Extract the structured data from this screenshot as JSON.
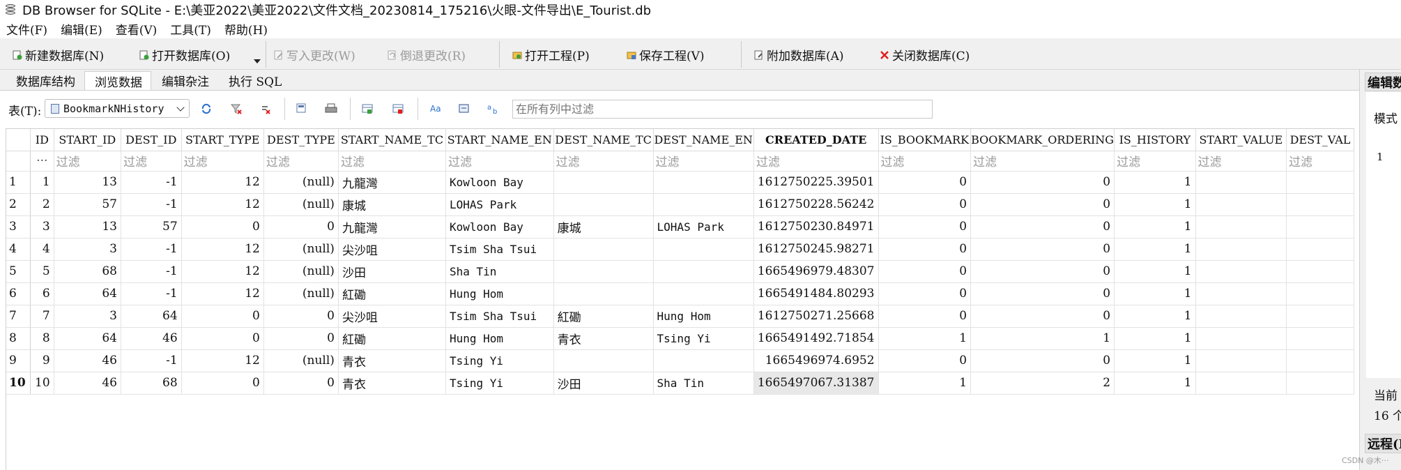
{
  "window": {
    "title": "DB Browser for SQLite - E:\\美亚2022\\美亚2022\\文件文档_20230814_175216\\火眼-文件导出\\E_Tourist.db"
  },
  "menu": [
    "文件(F)",
    "编辑(E)",
    "查看(V)",
    "工具(T)",
    "帮助(H)"
  ],
  "toolbar": {
    "new_db": "新建数据库(N)",
    "open_db": "打开数据库(O)",
    "write_changes": "写入更改(W)",
    "revert_changes": "倒退更改(R)",
    "open_project": "打开工程(P)",
    "save_project": "保存工程(V)",
    "attach_db": "附加数据库(A)",
    "close_db": "关闭数据库(C)"
  },
  "tabs": [
    "数据库结构",
    "浏览数据",
    "编辑杂注",
    "执行 SQL"
  ],
  "active_tab": "浏览数据",
  "browse": {
    "table_label": "表(T):",
    "table_name": "BookmarkNHistory",
    "filter_all_placeholder": "在所有列中过滤",
    "filter_corner": "···",
    "filter_placeholder": "过滤"
  },
  "grid": {
    "columns": [
      "ID",
      "START_ID",
      "DEST_ID",
      "START_TYPE",
      "DEST_TYPE",
      "START_NAME_TC",
      "START_NAME_EN",
      "DEST_NAME_TC",
      "DEST_NAME_EN",
      "CREATED_DATE",
      "IS_BOOKMARK",
      "BOOKMARK_ORDERING",
      "IS_HISTORY",
      "START_VALUE",
      "DEST_VAL"
    ],
    "sorted_column": "CREATED_DATE",
    "current_row": "10",
    "rows": [
      {
        "n": "1",
        "cells": [
          "1",
          "13",
          "-1",
          "12",
          "(null)",
          "九龍灣",
          "Kowloon Bay",
          "",
          "",
          "1612750225.39501",
          "0",
          "0",
          "1",
          "",
          ""
        ]
      },
      {
        "n": "2",
        "cells": [
          "2",
          "57",
          "-1",
          "12",
          "(null)",
          "康城",
          "LOHAS Park",
          "",
          "",
          "1612750228.56242",
          "0",
          "0",
          "1",
          "",
          ""
        ]
      },
      {
        "n": "3",
        "cells": [
          "3",
          "13",
          "57",
          "0",
          "0",
          "九龍灣",
          "Kowloon Bay",
          "康城",
          "LOHAS Park",
          "1612750230.84971",
          "0",
          "0",
          "1",
          "",
          ""
        ]
      },
      {
        "n": "4",
        "cells": [
          "4",
          "3",
          "-1",
          "12",
          "(null)",
          "尖沙咀",
          "Tsim Sha Tsui",
          "",
          "",
          "1612750245.98271",
          "0",
          "0",
          "1",
          "",
          ""
        ]
      },
      {
        "n": "5",
        "cells": [
          "5",
          "68",
          "-1",
          "12",
          "(null)",
          "沙田",
          "Sha Tin",
          "",
          "",
          "1665496979.48307",
          "0",
          "0",
          "1",
          "",
          ""
        ]
      },
      {
        "n": "6",
        "cells": [
          "6",
          "64",
          "-1",
          "12",
          "(null)",
          "紅磡",
          "Hung Hom",
          "",
          "",
          "1665491484.80293",
          "0",
          "0",
          "1",
          "",
          ""
        ]
      },
      {
        "n": "7",
        "cells": [
          "7",
          "3",
          "64",
          "0",
          "0",
          "尖沙咀",
          "Tsim Sha Tsui",
          "紅磡",
          "Hung Hom",
          "1612750271.25668",
          "0",
          "0",
          "1",
          "",
          ""
        ]
      },
      {
        "n": "8",
        "cells": [
          "8",
          "64",
          "46",
          "0",
          "0",
          "紅磡",
          "Hung Hom",
          "青衣",
          "Tsing Yi",
          "1665491492.71854",
          "1",
          "1",
          "1",
          "",
          ""
        ]
      },
      {
        "n": "9",
        "cells": [
          "9",
          "46",
          "-1",
          "12",
          "(null)",
          "青衣",
          "Tsing Yi",
          "",
          "",
          "1665496974.6952",
          "0",
          "0",
          "1",
          "",
          ""
        ]
      },
      {
        "n": "10",
        "cells": [
          "10",
          "46",
          "68",
          "0",
          "0",
          "青衣",
          "Tsing Yi",
          "沙田",
          "Sha Tin",
          "1665497067.31387",
          "1",
          "2",
          "1",
          "",
          ""
        ]
      }
    ]
  },
  "right_pane": {
    "title": "编辑数",
    "mode": "模式",
    "line": "1",
    "current": "当前",
    "count": "16 个",
    "remote": "远程(R"
  },
  "watermark": "CSDN @木···"
}
